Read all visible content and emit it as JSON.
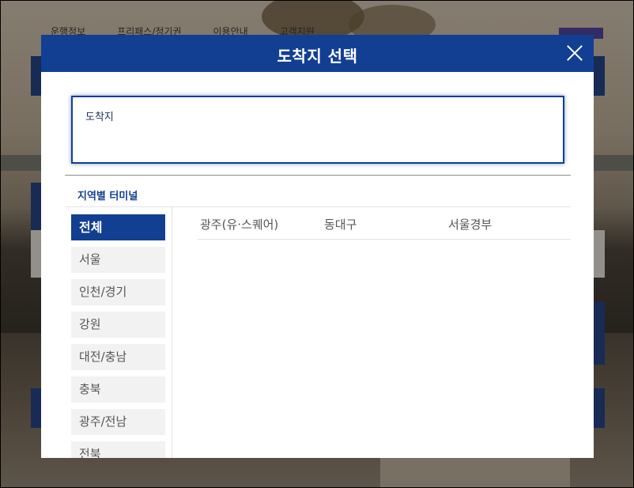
{
  "background": {
    "nav_items": [
      "운행정보",
      "프리패스/정기권",
      "이용안내",
      "고객지원"
    ]
  },
  "modal": {
    "title": "도착지 선택",
    "destination_placeholder": "도착지",
    "section_title": "지역별 터미널",
    "regions": [
      "전체",
      "서울",
      "인천/경기",
      "강원",
      "대전/충남",
      "충북",
      "광주/전남",
      "전북"
    ],
    "active_region": "전체",
    "terminals": [
      "광주(유·스퀘어)",
      "동대구",
      "서울경부"
    ]
  },
  "colors": {
    "primary_blue": "#123f91",
    "inactive_tab_bg": "#f2f2f2"
  }
}
